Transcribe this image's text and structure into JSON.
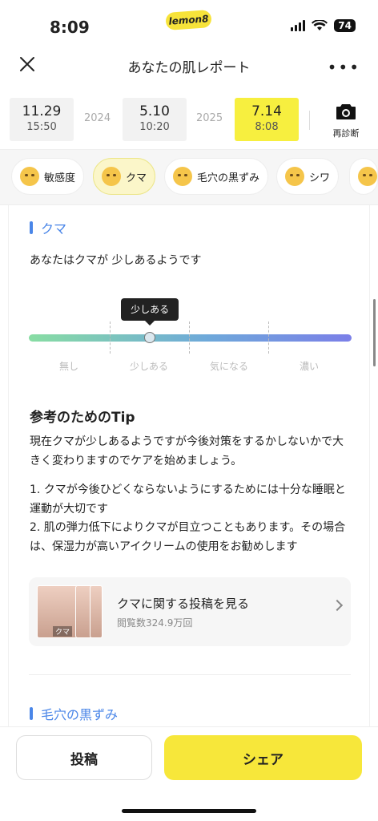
{
  "status": {
    "time": "8:09",
    "logo": "lemon8",
    "battery": "74"
  },
  "nav": {
    "title": "あなたの肌レポート",
    "more": "•••"
  },
  "timeline": {
    "items": [
      {
        "date": "11.29",
        "time": "15:50"
      },
      {
        "date": "5.10",
        "time": "10:20"
      },
      {
        "date": "7.14",
        "time": "8:08"
      }
    ],
    "years": [
      "2024",
      "2025"
    ],
    "rediagnose": "再診断"
  },
  "tabs": [
    {
      "label": "敏感度"
    },
    {
      "label": "クマ"
    },
    {
      "label": "毛穴の黒ずみ"
    },
    {
      "label": "シワ"
    }
  ],
  "section": {
    "title": "クマ",
    "summary": "あなたはクマが 少しあるようです",
    "tooltip": "少しある",
    "levels": [
      "無し",
      "少しある",
      "気になる",
      "濃い"
    ],
    "level_value": 0.375,
    "tip_title": "参考のためのTip",
    "paragraphs": [
      "現在クマが少しあるようですが今後対策をするかしないかで大きく変わりますのでケアを始めましょう。",
      "1. クマが今後ひどくならないようにするためには十分な睡眠と運動が大切です",
      "2. 肌の弾力低下によりクマが目立つこともあります。その場合は、保湿力が高いアイクリームの使用をお勧めします"
    ],
    "post_card": {
      "title": "クマに関する投稿を見る",
      "views": "閲覧数324.9万回",
      "thumb_label": "クマ"
    }
  },
  "next_section": {
    "title": "毛穴の黒ずみ"
  },
  "bottom": {
    "post_label": "投稿",
    "share_label": "シェア"
  },
  "colors": {
    "accent_yellow": "#f7e73a",
    "accent_blue": "#4a86e8"
  }
}
